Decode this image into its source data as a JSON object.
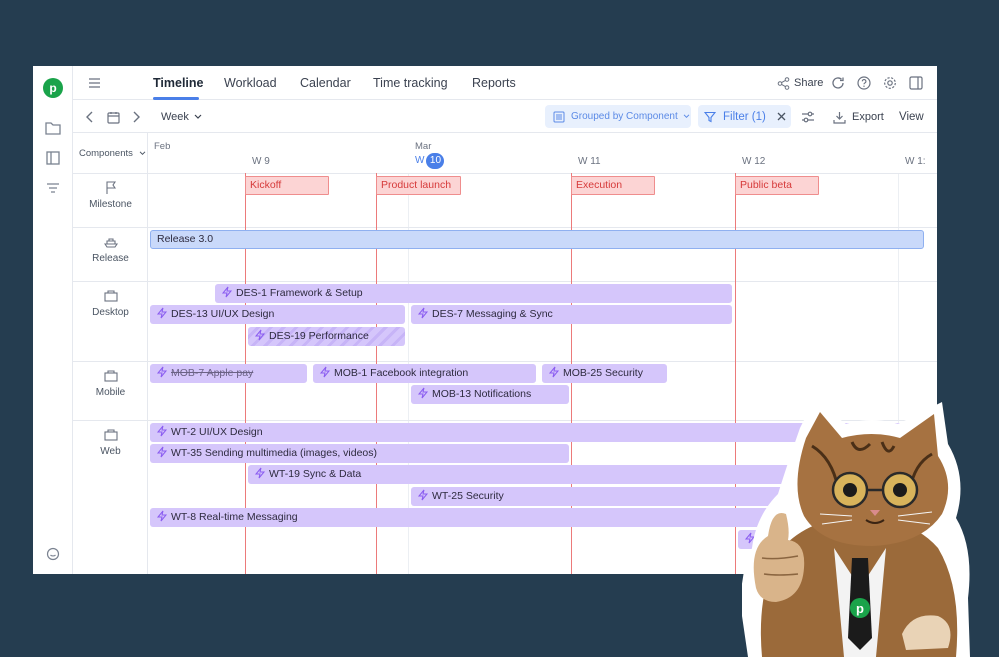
{
  "nav": {
    "tabs": [
      {
        "label": "Timeline",
        "active": true
      },
      {
        "label": "Workload"
      },
      {
        "label": "Calendar"
      },
      {
        "label": "Time tracking"
      },
      {
        "label": "Reports"
      }
    ],
    "share_label": "Share"
  },
  "toolbar": {
    "scale_label": "Week",
    "grouped_label": "Grouped by Component",
    "filter_label": "Filter (1)",
    "export_label": "Export",
    "view_label": "View"
  },
  "timeline": {
    "components_label": "Components",
    "months": [
      "Feb",
      "Mar"
    ],
    "weeks": [
      "W 9",
      "W",
      "W 11",
      "W 12",
      "W 1:"
    ],
    "today_badge": "10",
    "rows": [
      "Milestone",
      "Release",
      "Desktop",
      "Mobile",
      "Web"
    ],
    "milestones": [
      "Kickoff",
      "Product launch",
      "Execution",
      "Public beta"
    ],
    "release": "Release 3.0",
    "desktop": [
      "DES-1 Framework & Setup",
      "DES-13 UI/UX Design",
      "DES-7 Messaging & Sync",
      "DES-19 Performance"
    ],
    "mobile": [
      "MOB-7 Apple pay",
      "MOB-1 Facebook integration",
      "MOB-25 Security",
      "MOB-13 Notifications"
    ],
    "web": [
      "WT-2 UI/UX Design",
      "WT-35 Sending multimedia (images, videos)",
      "WT-19 Sync & Data",
      "WT-25 Security",
      "WT-8 Real-time Messaging"
    ]
  },
  "colors": {
    "background": "#253d50",
    "accent": "#4a7fe8",
    "brand_green": "#1aa34a",
    "milestone_red": "#ec7a7a",
    "task_purple": "#d5c6fb",
    "release_blue": "#c9d9fa"
  },
  "icons": [
    "logo-icon",
    "folder-icon",
    "board-icon",
    "filter-list-icon",
    "chat-icon",
    "menu-icon",
    "share-icon",
    "refresh-icon",
    "help-icon",
    "settings-icon",
    "panel-icon",
    "chevron-left-icon",
    "calendar-icon",
    "chevron-right-icon",
    "filter-icon",
    "close-icon",
    "sliders-icon",
    "export-icon",
    "flag-icon",
    "ship-icon",
    "box-icon",
    "bolt-icon"
  ]
}
